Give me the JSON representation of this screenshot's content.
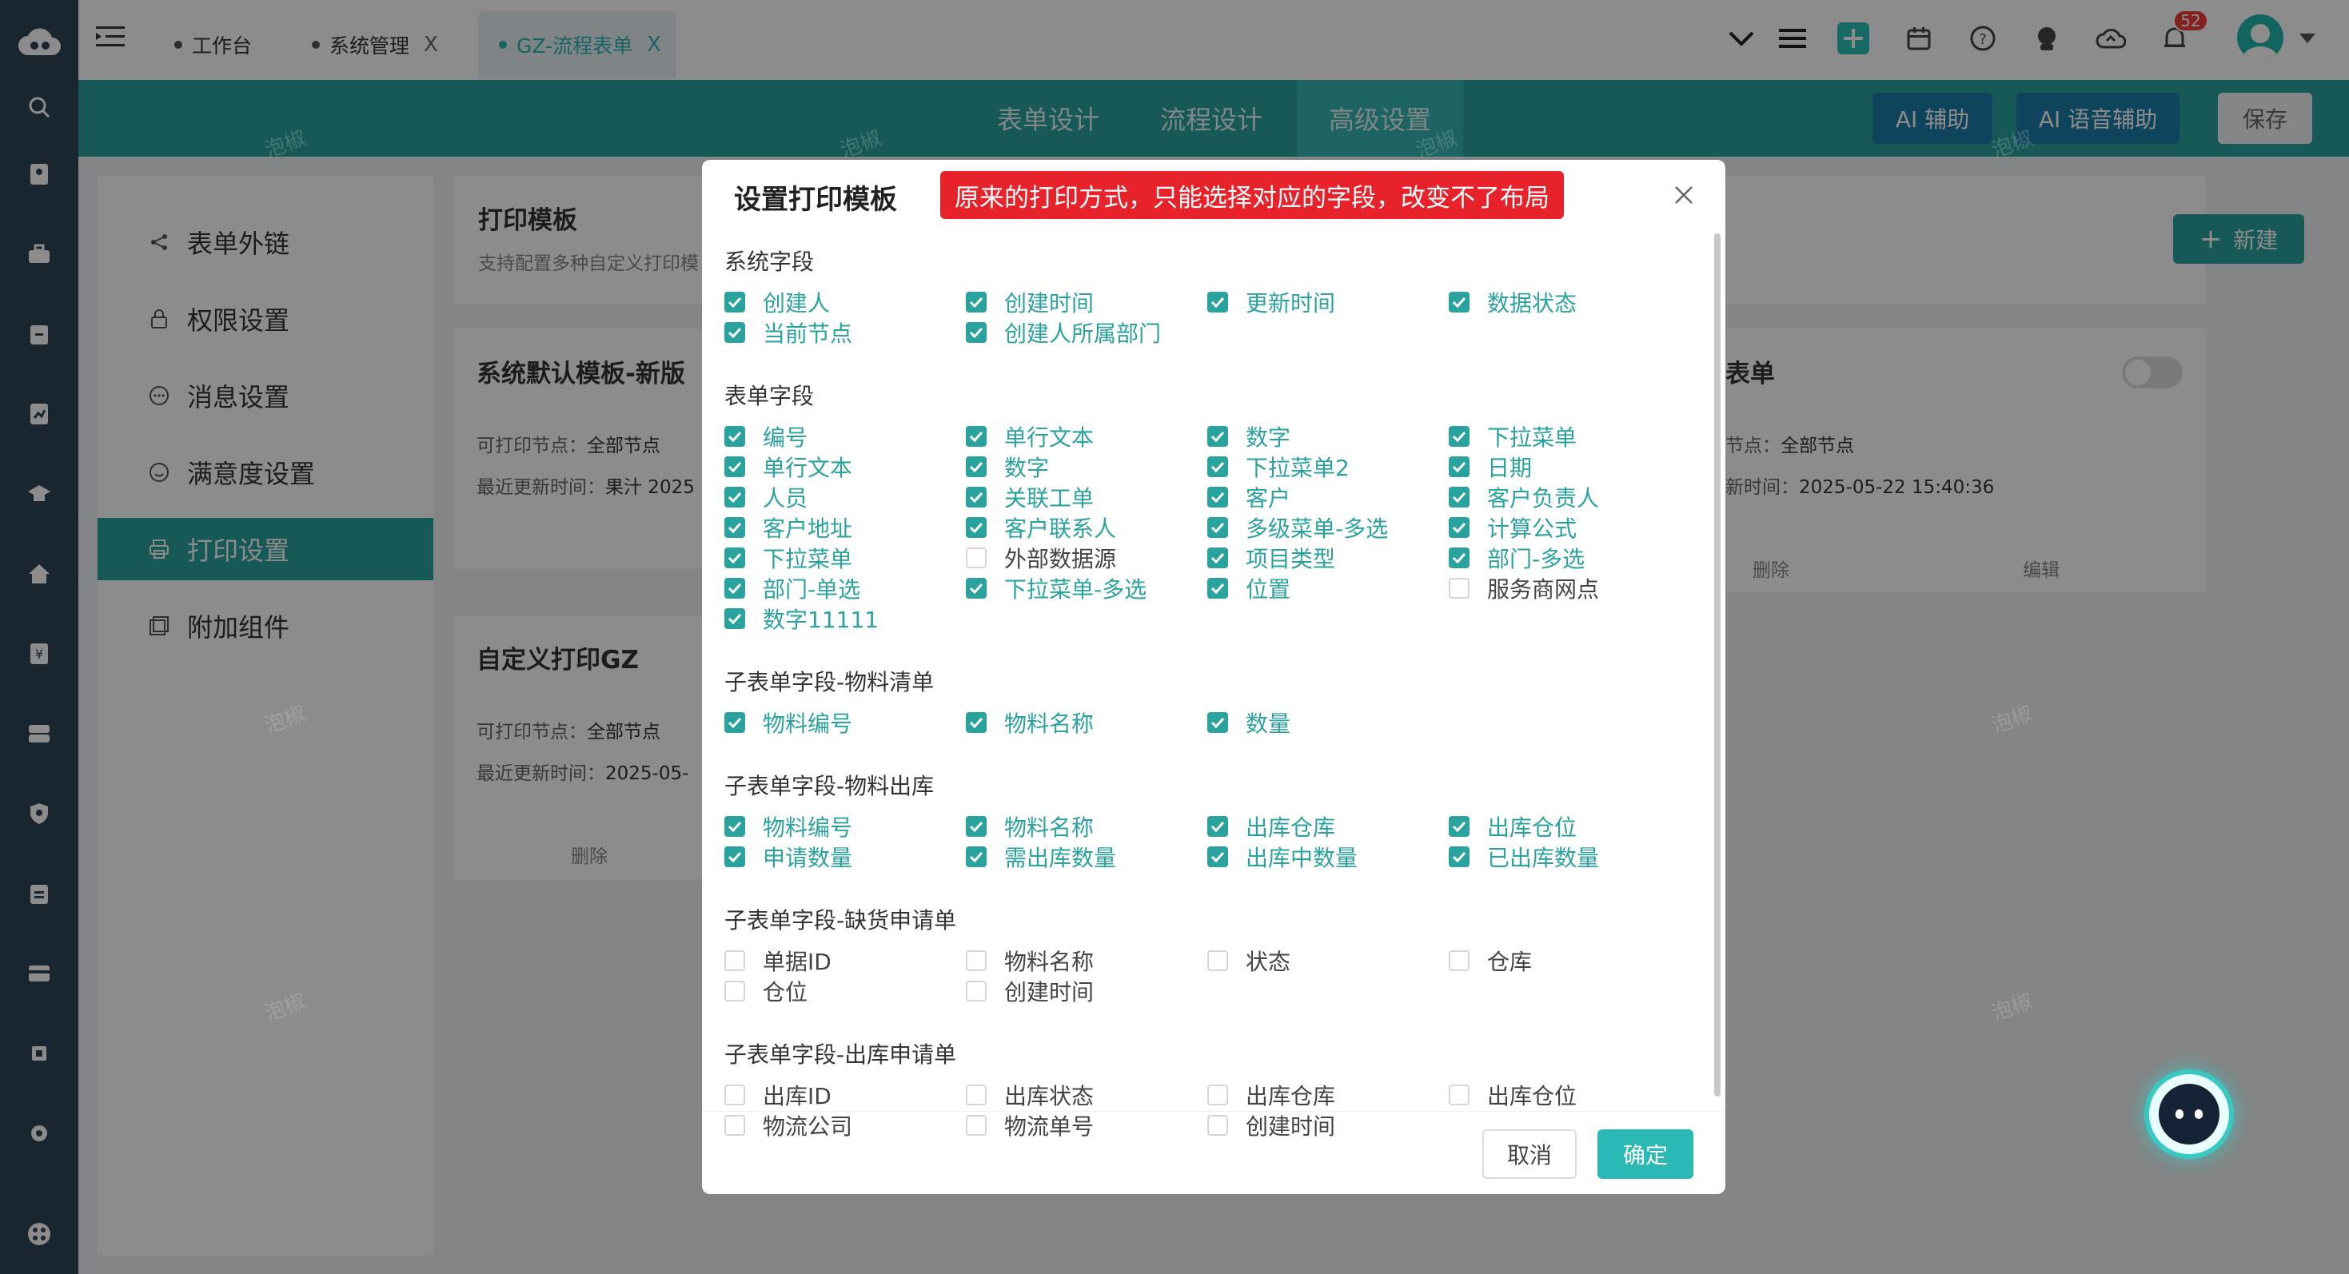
{
  "topbar": {
    "tabs": [
      {
        "label": "工作台",
        "closable": false
      },
      {
        "label": "系统管理",
        "closable": true
      },
      {
        "label": "GZ-流程表单",
        "closable": true,
        "active": true
      }
    ],
    "close_glyph": "X",
    "notification_count": "52"
  },
  "header": {
    "tabs": [
      "表单设计",
      "流程设计",
      "高级设置"
    ],
    "active_tab": "高级设置",
    "ai_assist": "AI 辅助",
    "ai_voice": "AI 语音辅助",
    "save": "保存"
  },
  "left_menu": {
    "items": [
      "表单外链",
      "权限设置",
      "消息设置",
      "满意度设置",
      "打印设置",
      "附加组件"
    ],
    "active": "打印设置"
  },
  "print_panel": {
    "title": "打印模板",
    "subtitle": "支持配置多种自定义打印模",
    "new_button": "新建"
  },
  "cards": [
    {
      "title": "系统默认模板-新版",
      "nodes_label": "可打印节点：",
      "nodes_value": "全部节点",
      "time_label": "最近更新时间：",
      "time_value": "果汁 2025"
    },
    {
      "title": "表单",
      "nodes_label": "节点：",
      "nodes_value": "全部节点",
      "time_label": "新时间：",
      "time_value": "2025-05-22 15:40:36",
      "delete": "删除",
      "edit": "编辑"
    },
    {
      "title": "自定义打印GZ",
      "nodes_label": "可打印节点：",
      "nodes_value": "全部节点",
      "time_label": "最近更新时间：",
      "time_value": "2025-05-",
      "delete": "删除"
    }
  ],
  "watermark": "泡椒",
  "modal": {
    "title": "设置打印模板",
    "note": "原来的打印方式，只能选择对应的字段，改变不了布局",
    "cancel": "取消",
    "confirm": "确定",
    "sections": [
      {
        "title": "系统字段",
        "fields": [
          {
            "label": "创建人",
            "checked": true
          },
          {
            "label": "创建时间",
            "checked": true
          },
          {
            "label": "更新时间",
            "checked": true
          },
          {
            "label": "数据状态",
            "checked": true
          },
          {
            "label": "当前节点",
            "checked": true
          },
          {
            "label": "创建人所属部门",
            "checked": true
          }
        ]
      },
      {
        "title": "表单字段",
        "fields": [
          {
            "label": "编号",
            "checked": true
          },
          {
            "label": "单行文本",
            "checked": true
          },
          {
            "label": "数字",
            "checked": true
          },
          {
            "label": "下拉菜单",
            "checked": true
          },
          {
            "label": "单行文本",
            "checked": true
          },
          {
            "label": "数字",
            "checked": true
          },
          {
            "label": "下拉菜单2",
            "checked": true
          },
          {
            "label": "日期",
            "checked": true
          },
          {
            "label": "人员",
            "checked": true
          },
          {
            "label": "关联工单",
            "checked": true
          },
          {
            "label": "客户",
            "checked": true
          },
          {
            "label": "客户负责人",
            "checked": true
          },
          {
            "label": "客户地址",
            "checked": true
          },
          {
            "label": "客户联系人",
            "checked": true
          },
          {
            "label": "多级菜单-多选",
            "checked": true
          },
          {
            "label": "计算公式",
            "checked": true
          },
          {
            "label": "下拉菜单",
            "checked": true
          },
          {
            "label": "外部数据源",
            "checked": false
          },
          {
            "label": "项目类型",
            "checked": true
          },
          {
            "label": "部门-多选",
            "checked": true
          },
          {
            "label": "部门-单选",
            "checked": true
          },
          {
            "label": "下拉菜单-多选",
            "checked": true
          },
          {
            "label": "位置",
            "checked": true
          },
          {
            "label": "服务商网点",
            "checked": false
          },
          {
            "label": "数字11111",
            "checked": true
          }
        ]
      },
      {
        "title": "子表单字段-物料清单",
        "fields": [
          {
            "label": "物料编号",
            "checked": true
          },
          {
            "label": "物料名称",
            "checked": true
          },
          {
            "label": "数量",
            "checked": true
          }
        ]
      },
      {
        "title": "子表单字段-物料出库",
        "fields": [
          {
            "label": "物料编号",
            "checked": true
          },
          {
            "label": "物料名称",
            "checked": true
          },
          {
            "label": "出库仓库",
            "checked": true
          },
          {
            "label": "出库仓位",
            "checked": true
          },
          {
            "label": "申请数量",
            "checked": true
          },
          {
            "label": "需出库数量",
            "checked": true
          },
          {
            "label": "出库中数量",
            "checked": true
          },
          {
            "label": "已出库数量",
            "checked": true
          }
        ]
      },
      {
        "title": "子表单字段-缺货申请单",
        "fields": [
          {
            "label": "单据ID",
            "checked": false
          },
          {
            "label": "物料名称",
            "checked": false
          },
          {
            "label": "状态",
            "checked": false
          },
          {
            "label": "仓库",
            "checked": false
          },
          {
            "label": "仓位",
            "checked": false
          },
          {
            "label": "创建时间",
            "checked": false
          }
        ]
      },
      {
        "title": "子表单字段-出库申请单",
        "fields": [
          {
            "label": "出库ID",
            "checked": false
          },
          {
            "label": "出库状态",
            "checked": false
          },
          {
            "label": "出库仓库",
            "checked": false
          },
          {
            "label": "出库仓位",
            "checked": false
          },
          {
            "label": "物流公司",
            "checked": false
          },
          {
            "label": "物流单号",
            "checked": false
          },
          {
            "label": "创建时间",
            "checked": false
          }
        ]
      }
    ]
  },
  "colors": {
    "teal": "#2aa39f",
    "rail": "#2f4456",
    "note_red": "#e8222b"
  }
}
